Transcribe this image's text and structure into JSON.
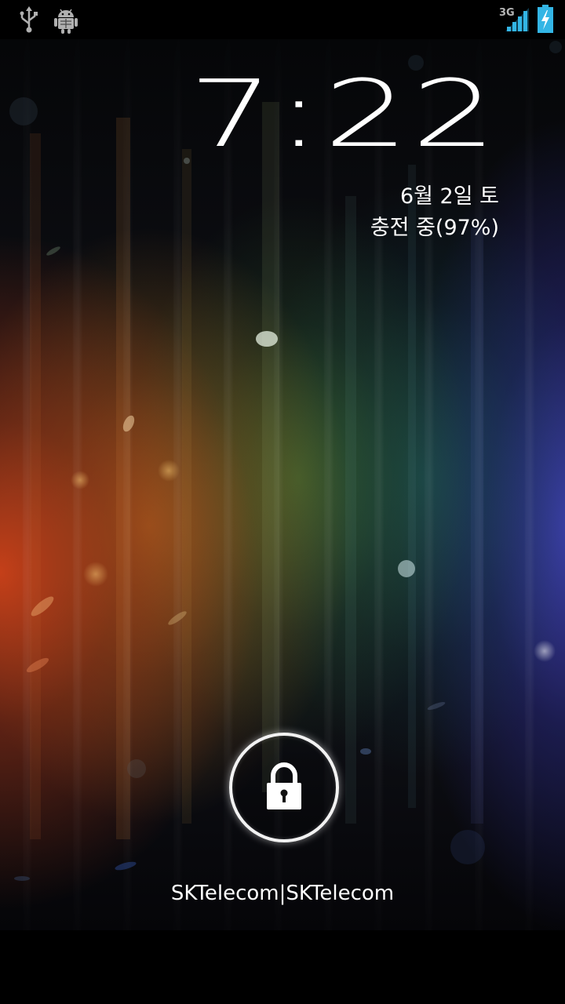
{
  "status_bar": {
    "left_icons": [
      "usb-icon",
      "android-debug-icon"
    ],
    "network_type": "3G",
    "signal_icon": "signal-strength-icon",
    "battery_icon": "battery-charging-icon",
    "accent_color": "#33b5e5"
  },
  "lockscreen": {
    "time": "7:22",
    "date": "6월 2일 토",
    "charging_status": "충전 중(97%)",
    "unlock_icon": "lock-icon",
    "carrier_label": "SKTelecom|SKTelecom"
  }
}
